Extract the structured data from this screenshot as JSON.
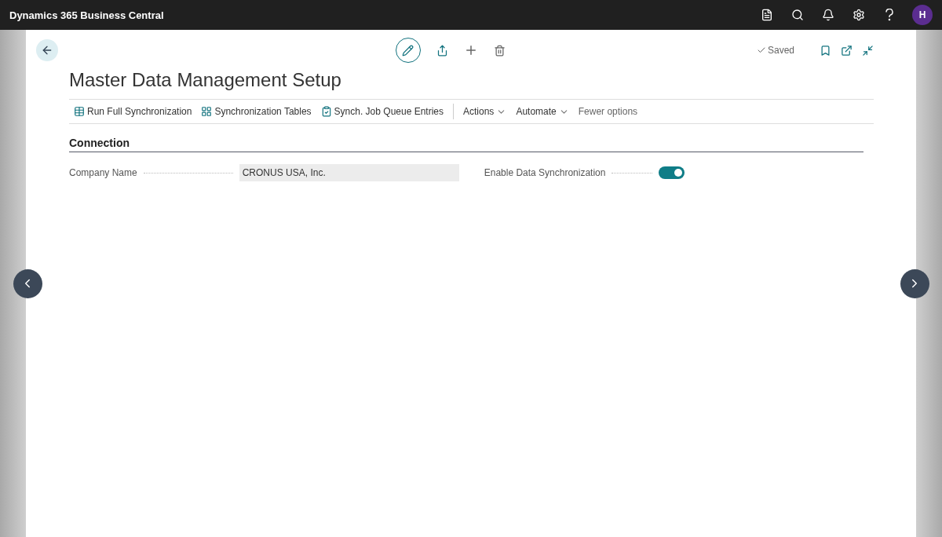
{
  "app_bar": {
    "title": "Dynamics 365 Business Central",
    "avatar": "H"
  },
  "page": {
    "title": "Master Data Management Setup",
    "status": "Saved",
    "actions": [
      {
        "kind": "action",
        "label": "Run Full Synchronization"
      },
      {
        "kind": "action",
        "label": "Synchronization Tables"
      },
      {
        "kind": "action",
        "label": "Synch. Job Queue Entries"
      },
      {
        "kind": "menu",
        "label": "Actions"
      },
      {
        "kind": "menu",
        "label": "Automate"
      },
      {
        "kind": "link",
        "label": "Fewer options"
      }
    ],
    "section": {
      "title": "Connection",
      "fields": [
        {
          "kind": "text",
          "label": "Company Name",
          "value": "CRONUS USA, Inc."
        },
        {
          "kind": "toggle",
          "label": "Enable Data Synchronization",
          "on": true
        }
      ]
    }
  }
}
